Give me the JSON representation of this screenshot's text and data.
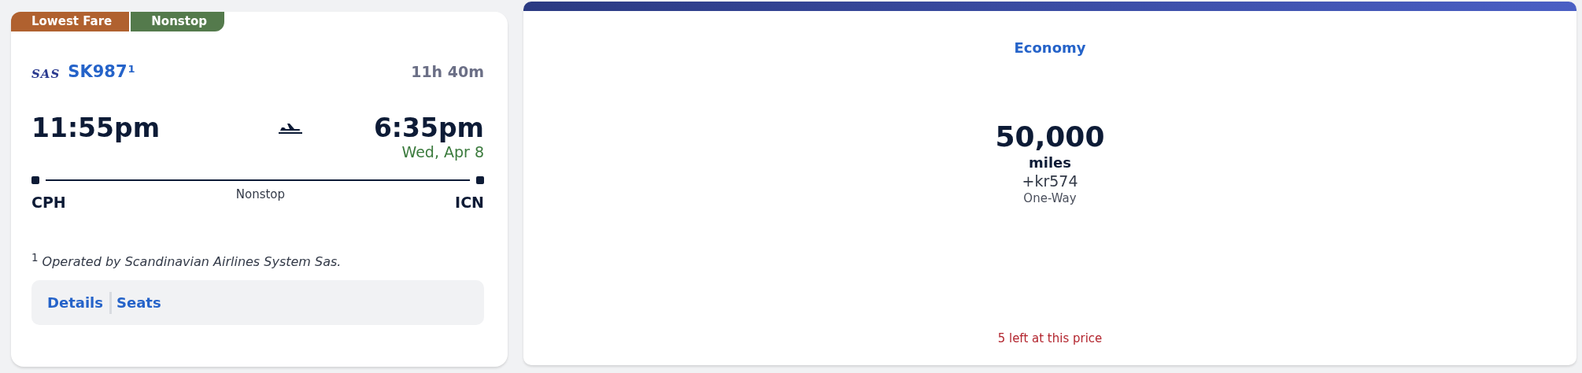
{
  "flight_card": {
    "tags": [
      {
        "label": "Lowest Fare",
        "color": "#b0612f"
      },
      {
        "label": "Nonstop",
        "color": "#547a4c"
      }
    ],
    "airline_logo": "SAS",
    "flight_number": "SK987",
    "footnote_mark": "1",
    "duration": "11h 40m",
    "departure": {
      "time": "11:55pm",
      "airport": "CPH"
    },
    "arrival": {
      "time": "6:35pm",
      "date": "Wed, Apr 8",
      "airport": "ICN"
    },
    "stops": "Nonstop",
    "footnote": "$^{1}$ *Operated by Scandinavian Airlines System Sas.*",
    "links": [
      "Details",
      "Seats"
    ]
  },
  "fare_card": {
    "cabin": "Economy",
    "miles": "50,000",
    "miles_unit": "miles",
    "taxes": "+kr574",
    "trip_type": "One-Way",
    "availability": "5 left at this price"
  }
}
